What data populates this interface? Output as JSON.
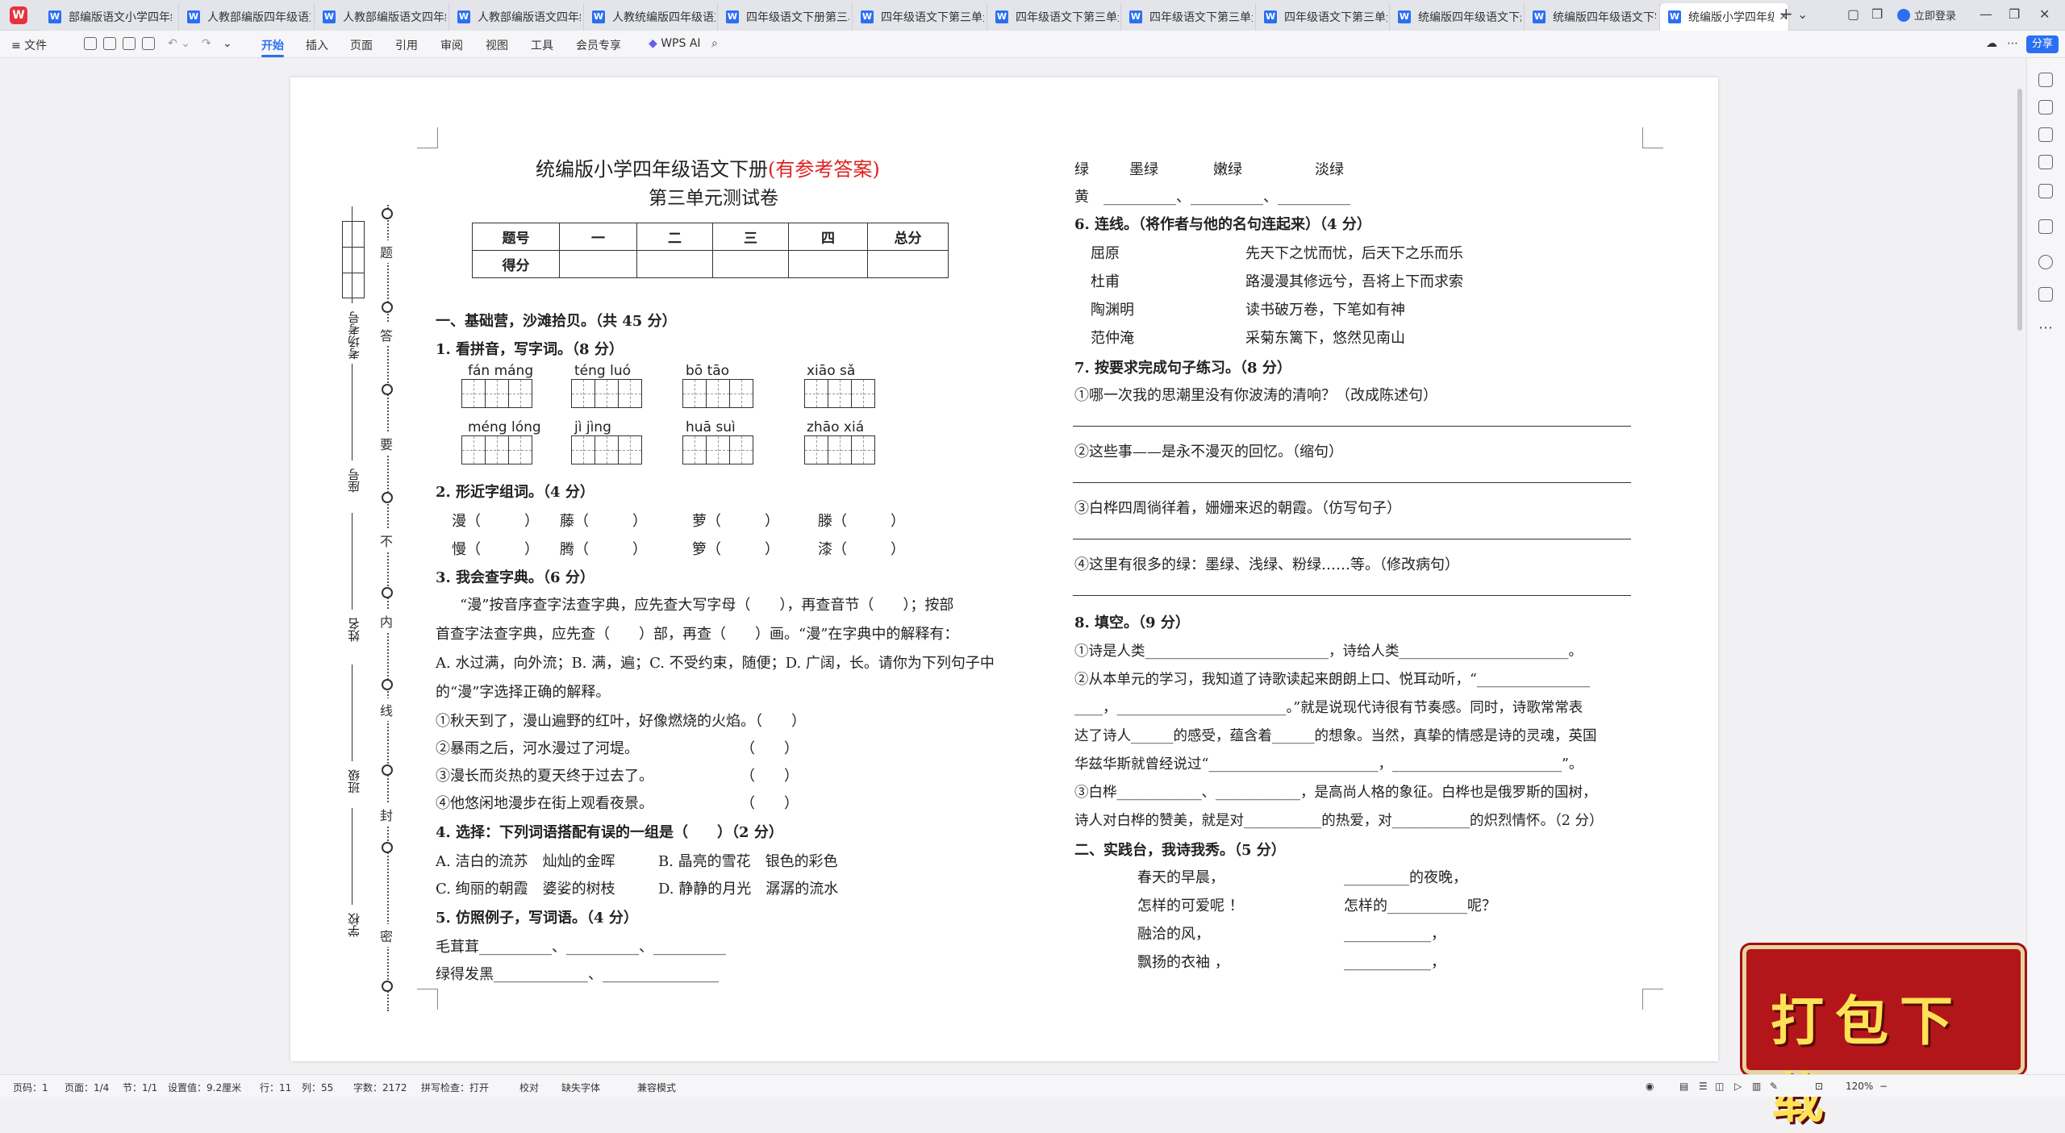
{
  "tabs": [
    {
      "label": "部编版语文小学四年级"
    },
    {
      "label": "人教部编版四年级语文"
    },
    {
      "label": "人教部编版语文四年级"
    },
    {
      "label": "人教部编版语文四年级"
    },
    {
      "label": "人教统编版四年级语文"
    },
    {
      "label": "四年级语文下册第三单"
    },
    {
      "label": "四年级语文下第三单元"
    },
    {
      "label": "四年级语文下第三单元"
    },
    {
      "label": "四年级语文下第三单元"
    },
    {
      "label": "四年级语文下第三单元"
    },
    {
      "label": "统编版四年级语文下册"
    },
    {
      "label": "统编版四年级语文下学"
    },
    {
      "label": "统编版小学四年级"
    }
  ],
  "window": {
    "login": "立即登录"
  },
  "menu": {
    "file": "≡ 文件",
    "items": [
      "开始",
      "插入",
      "页面",
      "引用",
      "审阅",
      "视图",
      "工具",
      "会员专享"
    ],
    "wps_ai": "WPS AI",
    "share": "分享"
  },
  "doc": {
    "title_main": "统编版小学四年级语文下册",
    "title_red": "(有参考答案)",
    "subtitle": "第三单元测试卷",
    "score_row1": [
      "题号",
      "一",
      "二",
      "三",
      "四",
      "总分"
    ],
    "score_row2": [
      "得分",
      "",
      "",
      "",
      "",
      ""
    ],
    "binding": {
      "seal_chars": [
        "题",
        "答",
        "要",
        "不",
        "内",
        "线",
        "封",
        "密"
      ],
      "labels": [
        "考场考号",
        "座号",
        "姓名",
        "班级",
        "学校"
      ]
    },
    "sec1": "一、基础营，沙滩拾贝。（共 45 分）",
    "q1": "1. 看拼音，写字词。（8 分）",
    "pinyin": [
      "fán máng",
      "téng luó",
      "bō tāo",
      "xiāo sǎ",
      "méng lóng",
      "jì jìng",
      "huā suì",
      "zhāo xiá"
    ],
    "q2": "2. 形近字组词。（4 分）",
    "q2_rows": [
      [
        "漫（　　　）",
        "藤（　　　）",
        "萝（　　　）",
        "滕（　　　）"
      ],
      [
        "慢（　　　）",
        "腾（　　　）",
        "箩（　　　）",
        "漆（　　　）"
      ]
    ],
    "q3": "3. 我会查字典。（6 分）",
    "q3_lines": [
      "“漫”按音序查字法查字典，应先查大写字母（　　），再查音节（　　）；按部",
      "首查字法查字典，应先查（　　）部，再查（　　）画。“漫”在字典中的解释有：",
      "A. 水过满，向外流；B. 满，遍；C. 不受约束，随便；D. 广阔，长。请你为下列句子中",
      "的“漫”字选择正确的解释。",
      "①秋天到了，漫山遍野的红叶，好像燃烧的火焰。（　　）",
      "②暴雨之后，河水漫过了河堤。　　　　　　　　（　　）",
      "③漫长而炎热的夏天终于过去了。　　　　　　　（　　）",
      "④他悠闲地漫步在街上观看夜景。　　　　　　　（　　）"
    ],
    "q4": "4. 选择：下列词语搭配有误的一组是（　　）（2 分）",
    "q4_opts": [
      "A. 洁白的流苏　灿灿的金晖",
      "B. 晶亮的雪花　银色的彩色",
      "C. 绚丽的朝霞　婆娑的树枝",
      "D. 静静的月光　潺潺的流水"
    ],
    "q5": "5. 仿照例子，写词语。（4 分）",
    "q5_lines": [
      "毛茸茸__________、__________、__________",
      "绿得发黑_____________、________________"
    ],
    "r_green": [
      "绿",
      "墨绿",
      "嫩绿",
      "淡绿"
    ],
    "r_yellow": "黄　__________、__________、__________",
    "q6": "6. 连线。（将作者与他的名句连起来）（4 分）",
    "q6_authors": [
      "屈原",
      "杜甫",
      "陶渊明",
      "范仲淹"
    ],
    "q6_quotes": [
      "先天下之忧而忧，后天下之乐而乐",
      "路漫漫其修远兮，吾将上下而求索",
      "读书破万卷，下笔如有神",
      "采菊东篱下，悠然见南山"
    ],
    "q7": "7. 按要求完成句子练习。（8 分）",
    "q7_items": [
      "①哪一次我的思潮里没有你波涛的清响？（改成陈述句）",
      "②这些事——是永不漫灭的回忆。（缩句）",
      "③白桦四周徜徉着，姗姗来迟的朝霞。（仿写句子）",
      "④这里有很多的绿：墨绿、浅绿、粉绿……等。（修改病句）"
    ],
    "q8": "8. 填空。（9 分）",
    "q8_lines": [
      "①诗是人类__________________________，诗给人类________________________。",
      "②从本单元的学习，我知道了诗歌读起来朗朗上口、悦耳动听，“________________",
      "____，________________________。”就是说现代诗很有节奏感。同时，诗歌常常表",
      "达了诗人______的感受，蕴含着______的想象。当然，真挚的情感是诗的灵魂，英国",
      "华兹华斯就曾经说过“________________________，________________________”。",
      "③白桦____________、____________，是高尚人格的象征。白桦也是俄罗斯的国树，",
      "诗人对白桦的赞美，就是对___________的热爱，对___________的炽烈情怀。（2 分）"
    ],
    "sec2": "二、实践台，我诗我秀。（5 分）",
    "sec2_left": [
      "春天的早晨，",
      "怎样的可爱呢 ！",
      "融洽的风，",
      "飘扬的衣袖 ，"
    ],
    "sec2_right": [
      "_________的夜晚，",
      "怎样的___________呢？",
      "____________，",
      "____________，"
    ]
  },
  "status": {
    "items": [
      "页码：1",
      "页面：1/4",
      "节：1/1",
      "设置值：9.2厘米",
      "行：11",
      "列：55",
      "字数：2172",
      "拼写检查：打开",
      "校对",
      "缺失字体",
      "兼容模式"
    ],
    "zoom": "120%"
  },
  "promo": {
    "text": "打包下载"
  }
}
